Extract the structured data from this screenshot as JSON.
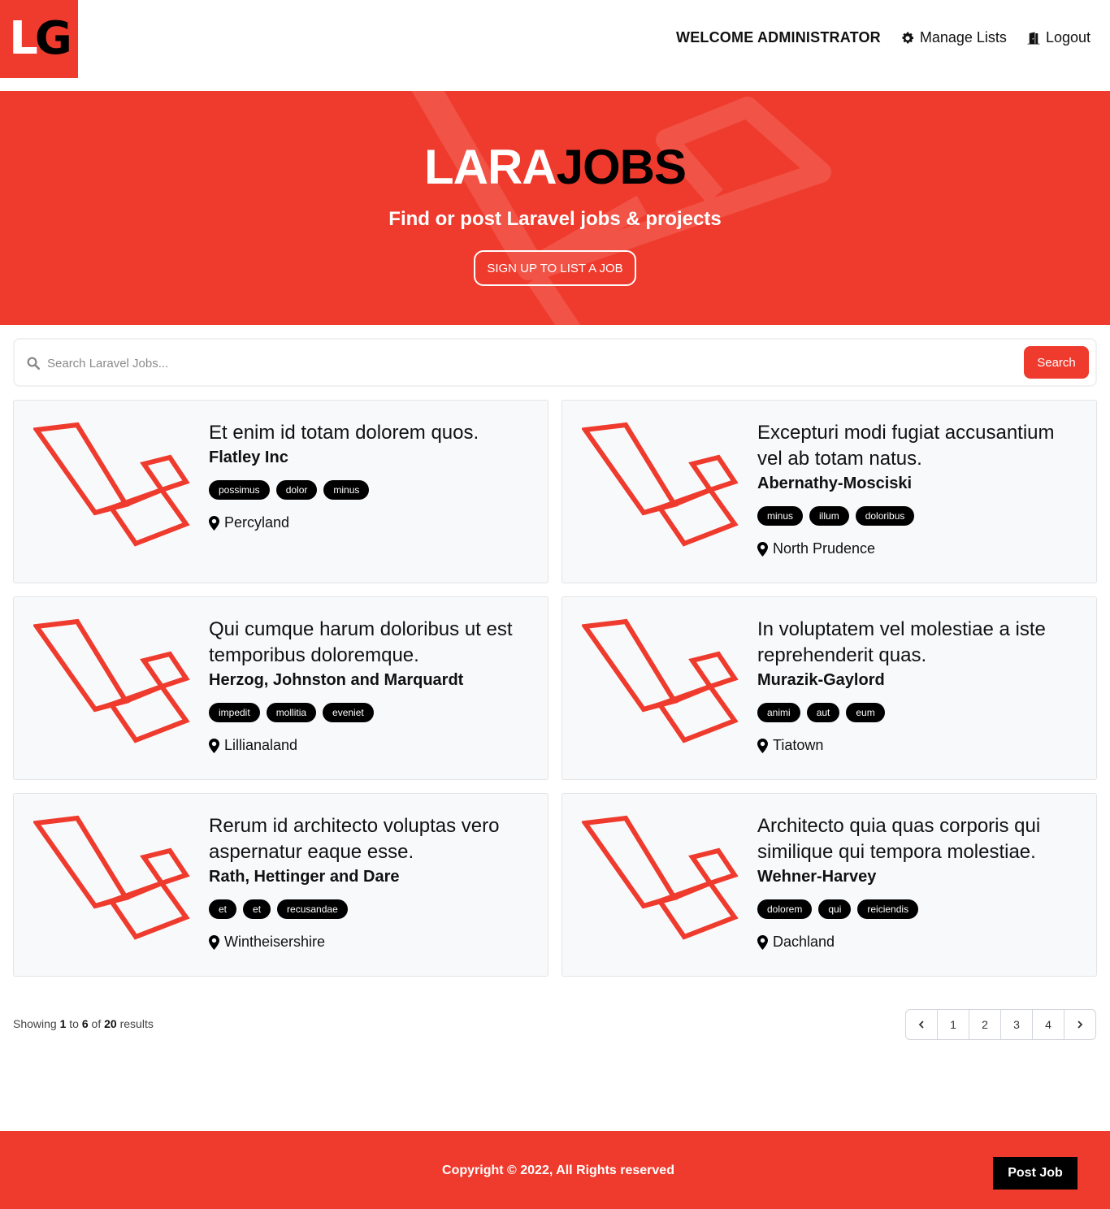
{
  "header": {
    "logo_text_l": "L",
    "logo_text_g": "G",
    "welcome": "Welcome Administrator",
    "manage_label": "Manage Lists",
    "logout_label": "Logout"
  },
  "hero": {
    "title_part1": "LARA",
    "title_part2": "JOBS",
    "subtitle": "Find or post Laravel jobs & projects",
    "signup_label": "Sign Up to List a Job"
  },
  "search": {
    "placeholder": "Search Laravel Jobs...",
    "button_label": "Search"
  },
  "listings": [
    {
      "title": "Et enim id totam dolorem quos.",
      "company": "Flatley Inc",
      "tags": [
        "possimus",
        "dolor",
        "minus"
      ],
      "location": "Percyland"
    },
    {
      "title": "Excepturi modi fugiat accusantium vel ab totam natus.",
      "company": "Abernathy-Mosciski",
      "tags": [
        "minus",
        "illum",
        "doloribus"
      ],
      "location": "North Prudence"
    },
    {
      "title": "Qui cumque harum doloribus ut est temporibus doloremque.",
      "company": "Herzog, Johnston and Marquardt",
      "tags": [
        "impedit",
        "mollitia",
        "eveniet"
      ],
      "location": "Lillianaland"
    },
    {
      "title": "In voluptatem vel molestiae a iste reprehenderit quas.",
      "company": "Murazik-Gaylord",
      "tags": [
        "animi",
        "aut",
        "eum"
      ],
      "location": "Tiatown"
    },
    {
      "title": "Rerum id architecto voluptas vero aspernatur eaque esse.",
      "company": "Rath, Hettinger and Dare",
      "tags": [
        "et",
        "et",
        "recusandae"
      ],
      "location": "Wintheisershire"
    },
    {
      "title": "Architecto quia quas corporis qui similique qui tempora molestiae.",
      "company": "Wehner-Harvey",
      "tags": [
        "dolorem",
        "qui",
        "reiciendis"
      ],
      "location": "Dachland"
    }
  ],
  "pagination": {
    "showing_prefix": "Showing",
    "from": "1",
    "to_word": "to",
    "to": "6",
    "of_word": "of",
    "total": "20",
    "results_word": "results",
    "pages": [
      "1",
      "2",
      "3",
      "4"
    ]
  },
  "footer": {
    "copyright": "Copyright © 2022, All Rights reserved",
    "post_job_label": "Post Job"
  },
  "colors": {
    "brand_red": "#ef3b2d",
    "tag_bg": "#000000",
    "card_bg": "#f8f9fb"
  },
  "icons": {
    "manage": "gear-icon",
    "logout": "door-icon",
    "search": "magnifier-icon",
    "location": "map-pin-icon",
    "prev": "chevron-left-icon",
    "next": "chevron-right-icon",
    "card_logo": "laravel-logo"
  }
}
